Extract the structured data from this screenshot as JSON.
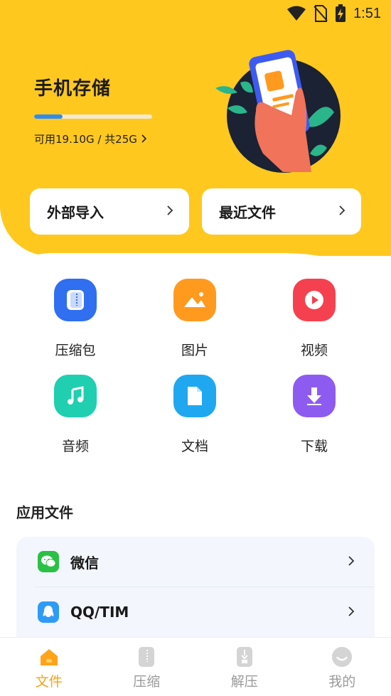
{
  "status_bar": {
    "time": "1:51"
  },
  "storage": {
    "title": "手机存储",
    "used_fraction": 0.24,
    "info": "可用19.10G / 共25G"
  },
  "quick_actions": [
    {
      "label": "外部导入"
    },
    {
      "label": "最近文件"
    }
  ],
  "categories": [
    {
      "label": "压缩包",
      "icon": "zip-icon",
      "color": "#2F6FF0"
    },
    {
      "label": "图片",
      "icon": "image-icon",
      "color": "#FF9A1F"
    },
    {
      "label": "视频",
      "icon": "play-icon",
      "color": "#F5414F"
    },
    {
      "label": "音频",
      "icon": "music-icon",
      "color": "#1FCFB0"
    },
    {
      "label": "文档",
      "icon": "document-icon",
      "color": "#1FA8F0"
    },
    {
      "label": "下载",
      "icon": "download-icon",
      "color": "#8E5BF0"
    }
  ],
  "app_files": {
    "title": "应用文件",
    "items": [
      {
        "name": "微信",
        "icon": "wechat-icon",
        "color": "#2AC146"
      },
      {
        "name": "QQ/TIM",
        "icon": "qq-icon",
        "color": "#2D9CF7"
      }
    ]
  },
  "bottom_nav": [
    {
      "label": "文件",
      "icon": "home-icon",
      "active": true
    },
    {
      "label": "压缩",
      "icon": "compress-icon",
      "active": false
    },
    {
      "label": "解压",
      "icon": "extract-icon",
      "active": false
    },
    {
      "label": "我的",
      "icon": "profile-icon",
      "active": false
    }
  ],
  "colors": {
    "accent": "#FFC81F",
    "nav_active": "#F5A31A",
    "progress": "#2F8CF0"
  }
}
